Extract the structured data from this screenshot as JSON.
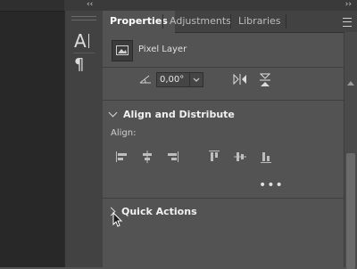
{
  "panel": {
    "collapse_left": "‹‹",
    "collapse_right": "››",
    "tabs": [
      {
        "label": "Properties",
        "active": true
      },
      {
        "label": "Adjustments",
        "active": false
      },
      {
        "label": "Libraries",
        "active": false
      }
    ],
    "menu_icon": "hamburger-menu-icon"
  },
  "toolstrip": {
    "tools": [
      {
        "glyph": "A",
        "icon": "character-panel-icon"
      },
      {
        "glyph": "¶",
        "icon": "paragraph-panel-icon"
      }
    ]
  },
  "layer": {
    "label": "Pixel Layer",
    "icon": "pixel-layer-thumbnail-icon"
  },
  "transform": {
    "angle_value": "0,00°",
    "icons": [
      "rotate-angle-icon",
      "flip-horizontal-icon",
      "flip-vertical-icon"
    ]
  },
  "align": {
    "title": "Align and Distribute",
    "label": "Align:",
    "buttons": [
      "align-left-edges-icon",
      "align-horizontal-centers-icon",
      "align-right-edges-icon",
      "align-top-edges-icon",
      "align-vertical-centers-icon",
      "align-bottom-edges-icon"
    ],
    "more": "•••"
  },
  "quick_actions": {
    "title": "Quick Actions"
  },
  "colors": {
    "panel_bg": "#535353",
    "tabbar_bg": "#424242",
    "canvas_bg": "#282828"
  }
}
